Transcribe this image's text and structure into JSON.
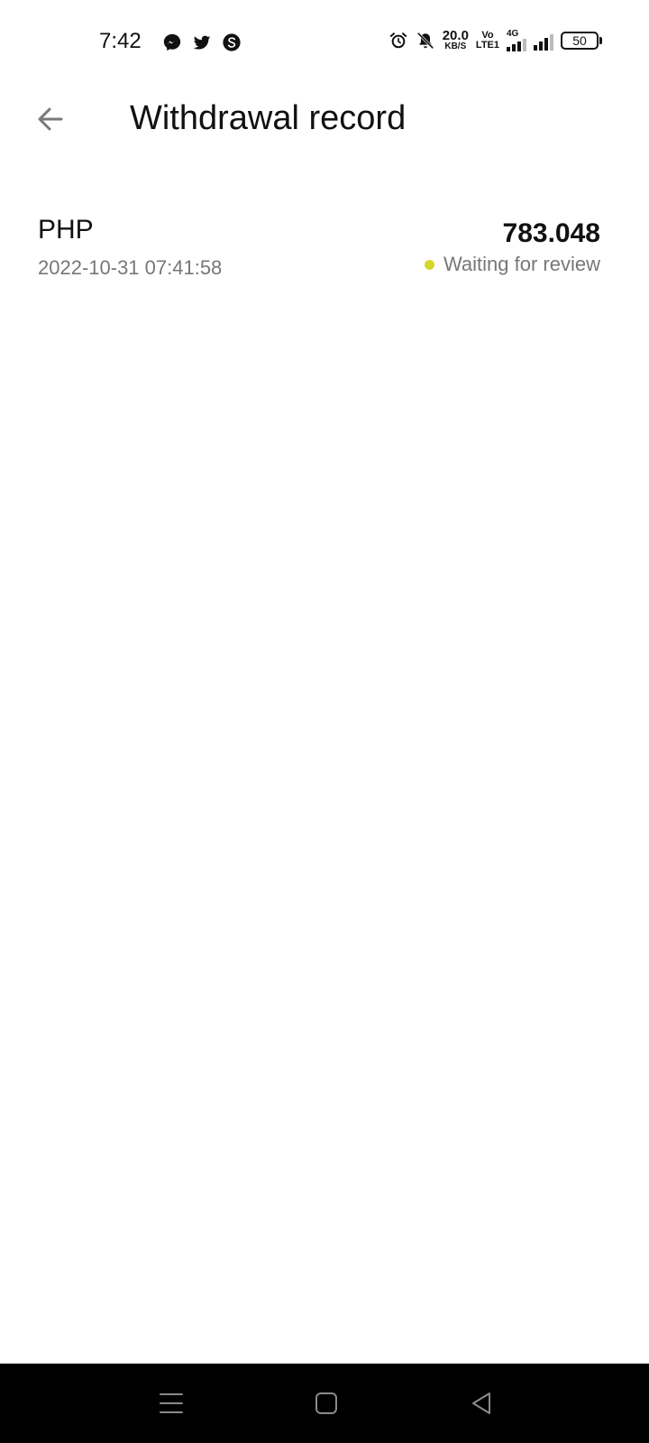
{
  "status_bar": {
    "time": "7:42",
    "notification_icons": [
      "messenger-icon",
      "twitter-icon",
      "s-app-icon"
    ],
    "system_icons": [
      "alarm-icon",
      "mute-icon",
      "network-speed",
      "volte-icon",
      "signal-4g-icon",
      "signal-icon",
      "battery-icon"
    ],
    "net_speed_value": "20.0",
    "net_speed_unit": "KB/S",
    "volte_top": "Vo",
    "volte_bottom": "LTE1",
    "network_type": "4G",
    "battery_level": "50"
  },
  "header": {
    "back_icon": "arrow-left-icon",
    "title": "Withdrawal record"
  },
  "records": [
    {
      "currency": "PHP",
      "datetime": "2022-10-31 07:41:58",
      "amount": "783.048",
      "status": "Waiting for review",
      "status_color": "#d7d62b"
    }
  ],
  "nav_bar": {
    "buttons": [
      "menu-icon",
      "home-icon",
      "back-triangle-icon"
    ]
  }
}
